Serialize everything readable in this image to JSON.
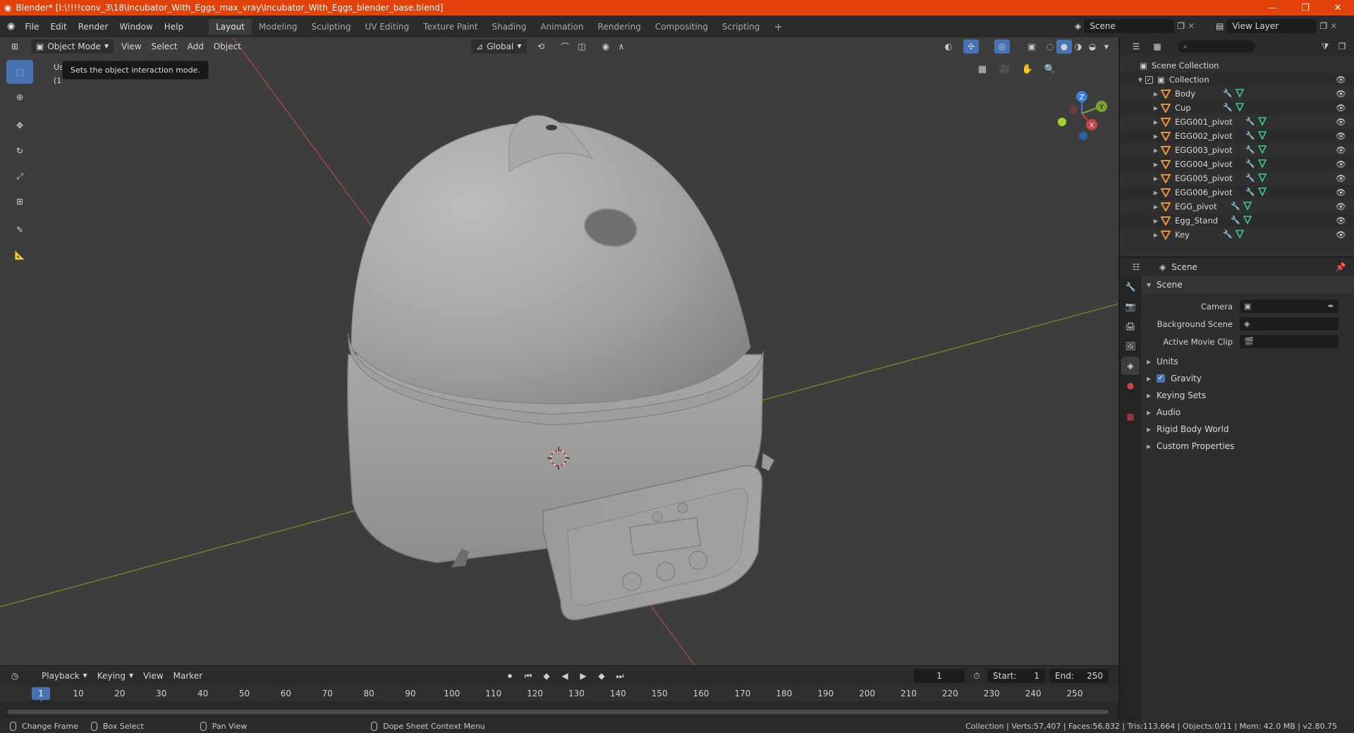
{
  "window": {
    "title": "Blender* [I:\\!!!!conv_3\\18\\Incubator_With_Eggs_max_vray\\Incubator_With_Eggs_blender_base.blend]",
    "minimize": "—",
    "maximize": "❐",
    "close": "✕"
  },
  "menu": [
    "File",
    "Edit",
    "Render",
    "Window",
    "Help"
  ],
  "workspaces": [
    {
      "label": "Layout",
      "active": true
    },
    {
      "label": "Modeling"
    },
    {
      "label": "Sculpting"
    },
    {
      "label": "UV Editing"
    },
    {
      "label": "Texture Paint"
    },
    {
      "label": "Shading"
    },
    {
      "label": "Animation"
    },
    {
      "label": "Rendering"
    },
    {
      "label": "Compositing"
    },
    {
      "label": "Scripting"
    }
  ],
  "add_workspace": "+",
  "scene_selector": {
    "value": "Scene"
  },
  "view_layer_selector": {
    "value": "View Layer"
  },
  "viewport": {
    "mode": "Object Mode",
    "menus": [
      "View",
      "Select",
      "Add",
      "Object"
    ],
    "orientation": "Global",
    "tooltip": "Sets the object interaction mode.",
    "info_line1": "Us",
    "info_line2": "(1",
    "gizmo": {
      "x": "X",
      "y": "Y",
      "z": "Z"
    }
  },
  "timeline": {
    "menus": [
      "Playback",
      "Keying",
      "View",
      "Marker"
    ],
    "current_frame": "1",
    "start_label": "Start:",
    "start_value": "1",
    "end_label": "End:",
    "end_value": "250",
    "ruler_ticks": [
      "1",
      "10",
      "20",
      "30",
      "40",
      "50",
      "60",
      "70",
      "80",
      "90",
      "100",
      "110",
      "120",
      "130",
      "140",
      "150",
      "160",
      "170",
      "180",
      "190",
      "200",
      "210",
      "220",
      "230",
      "240",
      "250"
    ]
  },
  "statusbar": {
    "items": [
      "Change Frame",
      "Box Select",
      "Pan View",
      "Dope Sheet Context Menu"
    ],
    "stats": "Collection | Verts:57,407 | Faces:56,832 | Tris:113,664 | Objects:0/11 | Mem: 42.0 MB | v2.80.75"
  },
  "outliner": {
    "scene_collection": "Scene Collection",
    "collection": "Collection",
    "objects": [
      "Body",
      "Cup",
      "EGG001_pivot",
      "EGG002_pivot",
      "EGG003_pivot",
      "EGG004_pivot",
      "EGG005_pivot",
      "EGG006_pivot",
      "EGG_pivot",
      "Egg_Stand",
      "Key"
    ]
  },
  "properties": {
    "context": "Scene",
    "panel_scene": "Scene",
    "fields": [
      {
        "label": "Camera",
        "value": ""
      },
      {
        "label": "Background Scene",
        "value": ""
      },
      {
        "label": "Active Movie Clip",
        "value": ""
      }
    ],
    "panels": [
      "Units",
      "Gravity",
      "Keying Sets",
      "Audio",
      "Rigid Body World",
      "Custom Properties"
    ]
  },
  "colors": {
    "titlebar": "#e2410a",
    "accent": "#4772b3",
    "viewport_bg": "#3d3d3d",
    "x_axis": "#c2454a",
    "y_axis": "#7ea32c",
    "z_axis": "#3d7fd8"
  }
}
